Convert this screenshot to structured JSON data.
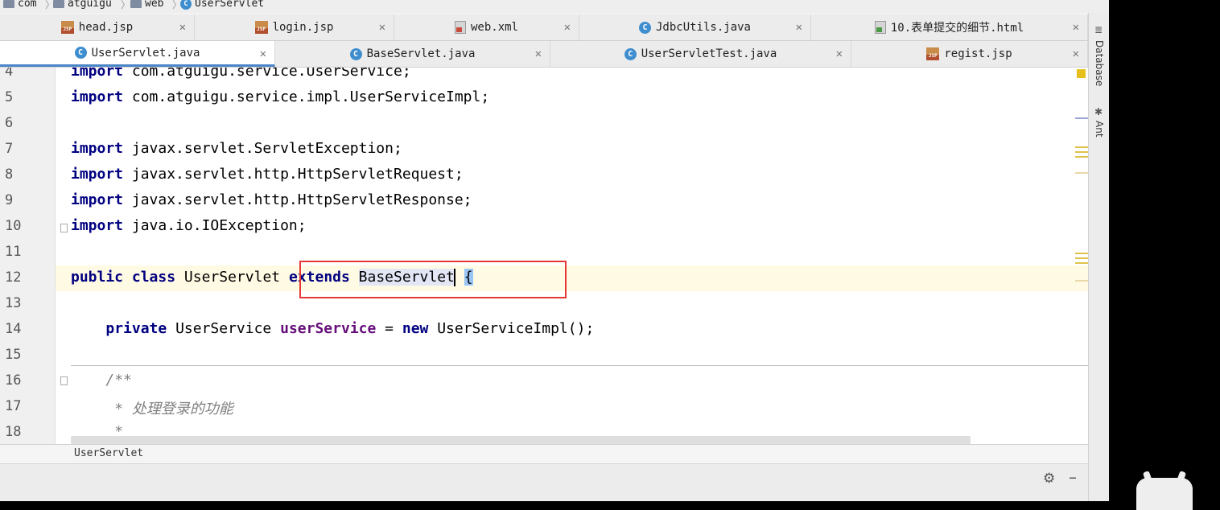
{
  "breadcrumb": [
    "com",
    "atguigu",
    "web",
    "UserServlet"
  ],
  "tabs_row1": [
    {
      "label": "head.jsp",
      "icon": "jsp-file-icon"
    },
    {
      "label": "login.jsp",
      "icon": "jsp-file-icon"
    },
    {
      "label": "web.xml",
      "icon": "xml-file-icon"
    },
    {
      "label": "JdbcUtils.java",
      "icon": "class-icon"
    },
    {
      "label": "10.表单提交的细节.html",
      "icon": "html-file-icon"
    }
  ],
  "tabs_row2": [
    {
      "label": "UserServlet.java",
      "icon": "class-icon",
      "active": true
    },
    {
      "label": "BaseServlet.java",
      "icon": "class-icon"
    },
    {
      "label": "UserServletTest.java",
      "icon": "test-class-icon"
    },
    {
      "label": "regist.jsp",
      "icon": "jsp-file-icon"
    }
  ],
  "editor": {
    "line_numbers": [
      "4",
      "5",
      "6",
      "7",
      "8",
      "9",
      "10",
      "11",
      "12",
      "13",
      "14",
      "15",
      "16",
      "17",
      "18"
    ],
    "lines": {
      "l4_kw": "import",
      "l4_rest": " com.atguigu.service.UserService;",
      "l5_kw": "import",
      "l5_rest": " com.atguigu.service.impl.UserServiceImpl;",
      "l7_kw": "import",
      "l7_rest": " javax.servlet.ServletException;",
      "l8_kw": "import",
      "l8_rest": " javax.servlet.http.HttpServletRequest;",
      "l9_kw": "import",
      "l9_rest": " javax.servlet.http.HttpServletResponse;",
      "l10_kw": "import",
      "l10_rest": " java.io.IOException;",
      "l12_kw1": "public",
      "l12_kw2": "class",
      "l12_name": "UserServlet",
      "l12_kw3": "extends",
      "l12_parent": "BaseServlet",
      "l12_brace": "{",
      "l14_kw1": "private",
      "l14_type": "UserService",
      "l14_field": "userService",
      "l14_eq": " = ",
      "l14_kw2": "new",
      "l14_rest": " UserServiceImpl();",
      "l16": "/**",
      "l17": " * 处理登录的功能",
      "l18": " *"
    }
  },
  "status_class_name": "UserServlet",
  "right_tool_windows": [
    "Database",
    "Ant"
  ],
  "colors": {
    "keyword": "#000080",
    "field": "#660e7a",
    "comment": "#808080",
    "highlight_box": "#e53935"
  }
}
